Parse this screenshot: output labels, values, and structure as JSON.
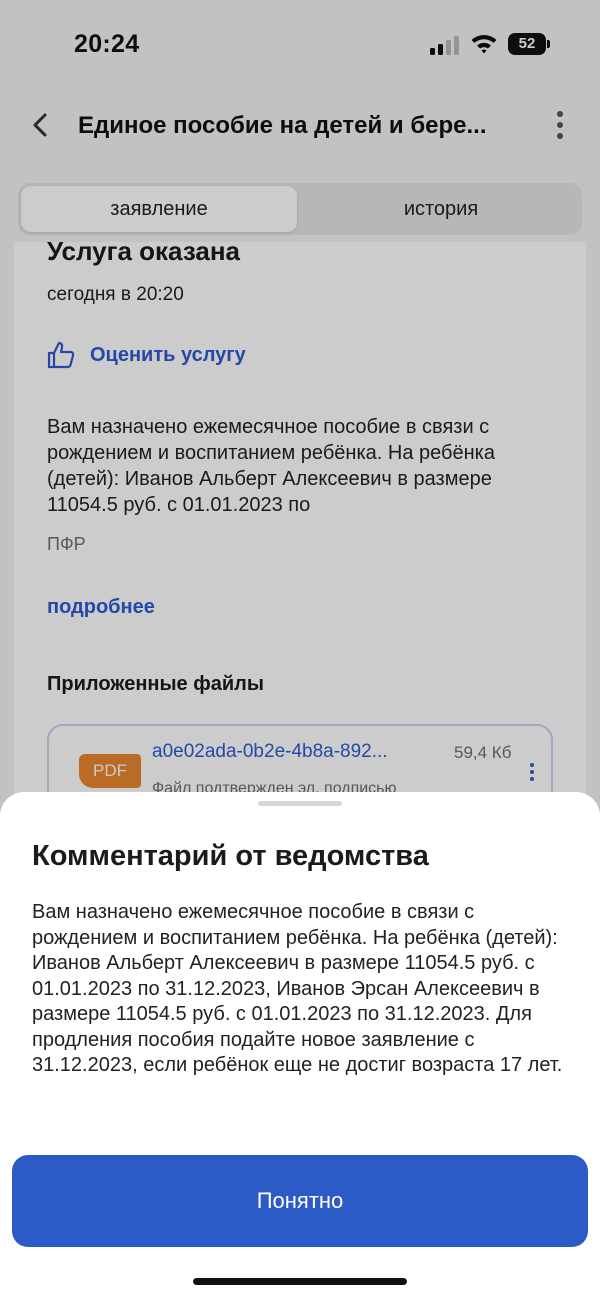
{
  "status_bar": {
    "time": "20:24",
    "battery": "52"
  },
  "nav": {
    "title": "Единое пособие на детей и бере..."
  },
  "tabs": [
    {
      "label": "заявление",
      "active": true
    },
    {
      "label": "история",
      "active": false
    }
  ],
  "card": {
    "heading": "Услуга оказана",
    "date": "сегодня в 20:20",
    "rate_label": "Оценить услугу",
    "text": "Вам назначено ежемесячное пособие в связи с рождением и воспитанием ребёнка. На ребёнка (детей): Иванов Альберт Алексеевич в размере 11054.5 руб. с 01.01.2023 по",
    "source": "ПФР",
    "more_label": "подробнее",
    "files_heading": "Приложенные файлы",
    "file": {
      "badge": "PDF",
      "name": "a0e02ada-0b2e-4b8a-892...",
      "size": "59,4 Кб",
      "status": "Файл подтвержден эл. подписью"
    }
  },
  "sheet": {
    "title": "Комментарий от ведомства",
    "text": "Вам назначено ежемесячное пособие в связи с рождением и воспитанием ребёнка. На ребёнка (детей): Иванов Альберт Алексеевич в размере 11054.5 руб. с 01.01.2023 по 31.12.2023, Иванов Эрсан Алексеевич в размере 11054.5 руб. с 01.01.2023 по 31.12.2023. Для продления пособия подайте новое заявление с 31.12.2023, если ребёнок еще не достиг возраста 17 лет.",
    "button_label": "Понятно"
  },
  "colors": {
    "accent": "#2d5bd3",
    "button": "#2c5bc7",
    "pdf_badge": "#e9862f"
  },
  "icons": [
    "signal-icon",
    "wifi-icon",
    "battery-icon",
    "back-icon",
    "more-icon",
    "thumbs-up-icon",
    "pdf-icon",
    "file-menu-icon"
  ]
}
